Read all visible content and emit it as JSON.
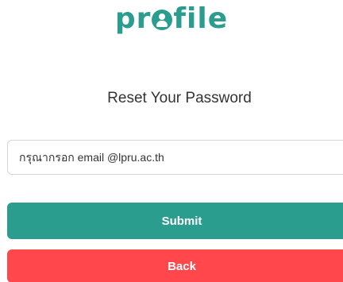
{
  "logo": {
    "prefix": "pr",
    "suffix": "file",
    "icon": "user-circle-icon"
  },
  "title": "Reset Your Password",
  "email_field": {
    "placeholder": "กรุณากรอก email @lpru.ac.th",
    "value": ""
  },
  "buttons": {
    "submit_label": "Submit",
    "back_label": "Back"
  },
  "colors": {
    "brand": "#2a9d8f",
    "submit": "#2a9d8f",
    "back": "#ff474c",
    "text": "#333333"
  }
}
